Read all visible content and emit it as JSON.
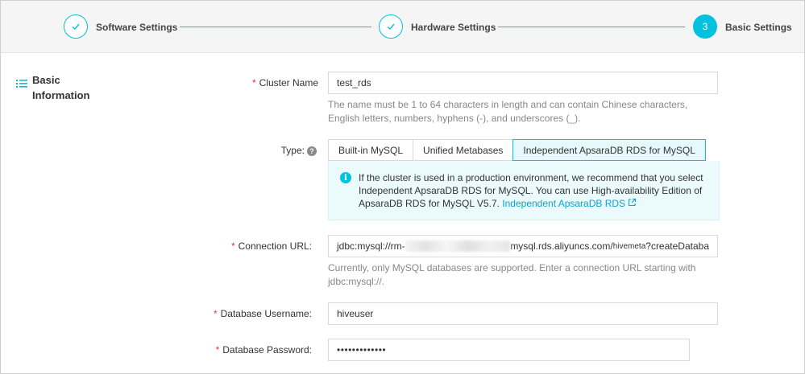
{
  "stepper": {
    "steps": [
      {
        "label": "Software Settings",
        "state": "done",
        "icon": "check-icon"
      },
      {
        "label": "Hardware Settings",
        "state": "done",
        "icon": "check-icon"
      },
      {
        "label": "Basic Settings",
        "state": "active",
        "number": "3"
      }
    ]
  },
  "section": {
    "title": "Basic Information",
    "icon": "list-icon"
  },
  "form": {
    "cluster_name": {
      "label": "Cluster Name",
      "value": "test_rds",
      "help": "The name must be 1 to 64 characters in length and can contain Chinese characters, English letters, numbers, hyphens (-), and underscores (_)."
    },
    "type": {
      "label": "Type:",
      "help_icon": "question-icon",
      "options": [
        "Built-in MySQL",
        "Unified Metabases",
        "Independent ApsaraDB RDS for MySQL"
      ],
      "selected": "Independent ApsaraDB RDS for MySQL",
      "notice": {
        "icon": "info-icon",
        "text": "If the cluster is used in a production environment, we recommend that you select Independent ApsaraDB RDS for MySQL. You can use High-availability Edition of ApsaraDB RDS for MySQL V5.7.",
        "link": "Independent ApsaraDB RDS",
        "link_icon": "external-link-icon"
      }
    },
    "connection_url": {
      "label": "Connection URL:",
      "value_prefix": "jdbc:mysql://rm-",
      "value_suffix": "mysql.rds.aliyuncs.com/",
      "value_db": "hivemeta",
      "value_end": "?createDataba",
      "help": "Currently, only MySQL databases are supported. Enter a connection URL starting with jdbc:mysql://."
    },
    "db_username": {
      "label": "Database Username:",
      "value": "hiveuser"
    },
    "db_password": {
      "label": "Database Password:",
      "value": "•••••••••••••"
    }
  },
  "colors": {
    "accent": "#00c1de",
    "required": "#e4393c",
    "link": "#0aa3d6"
  }
}
